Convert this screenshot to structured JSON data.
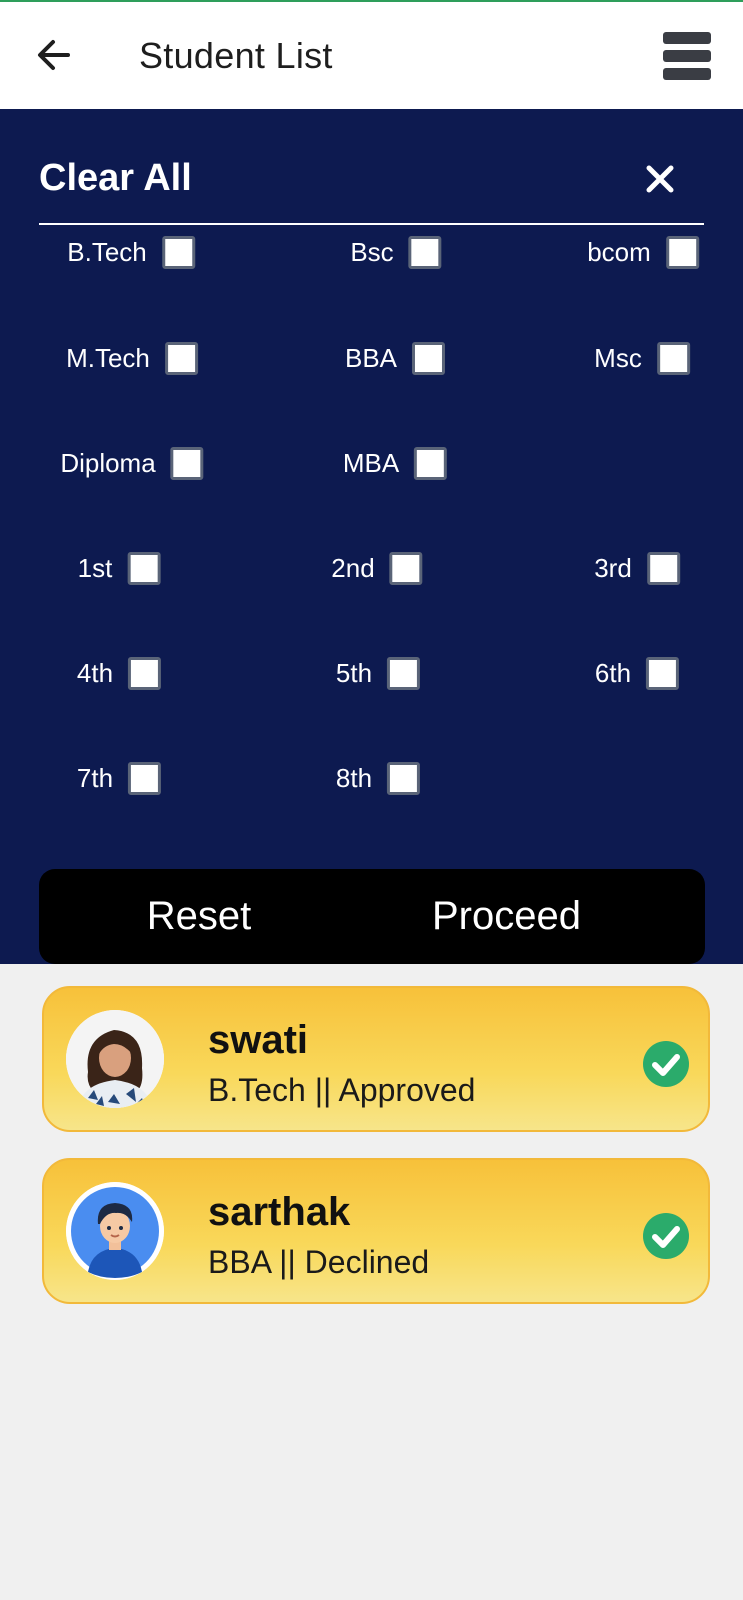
{
  "header": {
    "title": "Student List"
  },
  "filter": {
    "clear_all": "Clear All",
    "courses": [
      "B.Tech",
      "Bsc",
      "bcom",
      "M.Tech",
      "BBA",
      "Msc",
      "Diploma",
      "MBA"
    ],
    "semesters": [
      "1st",
      "2nd",
      "3rd",
      "4th",
      "5th",
      "6th",
      "7th",
      "8th"
    ],
    "checked": [],
    "reset_label": "Reset",
    "proceed_label": "Proceed"
  },
  "students": [
    {
      "name": "swati",
      "detail": "B.Tech || Approved",
      "status_icon": "check-circle-icon"
    },
    {
      "name": "sarthak",
      "detail": "BBA || Declined",
      "status_icon": "check-circle-icon"
    }
  ],
  "colors": {
    "panel": "#0d1a50",
    "card": "#f7c13a",
    "check": "#2bab6b"
  }
}
